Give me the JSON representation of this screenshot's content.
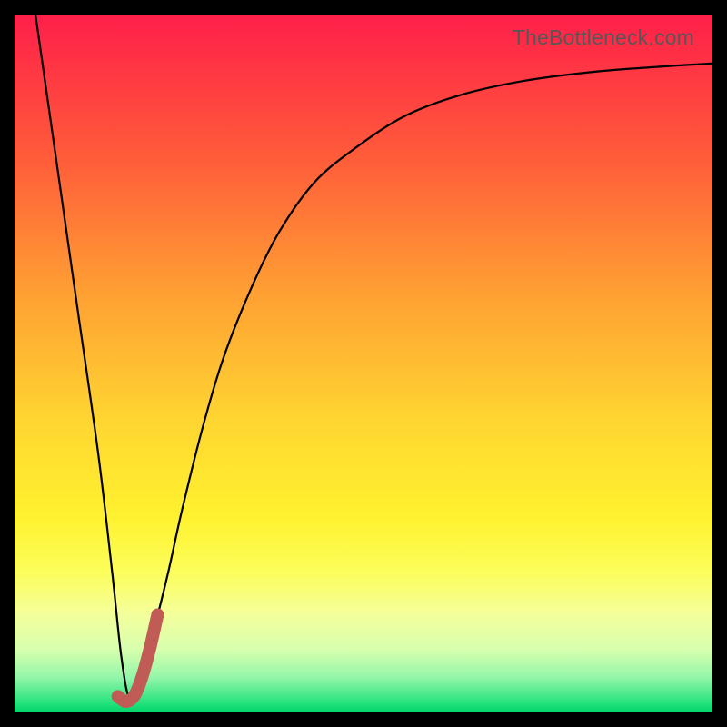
{
  "watermark": "TheBottleneck.com",
  "dimensions": {
    "outer": 800,
    "inset": 16
  },
  "chart_data": {
    "type": "line",
    "title": "",
    "xlabel": "",
    "ylabel": "",
    "xlim": [
      0,
      100
    ],
    "ylim": [
      0,
      100
    ],
    "grid": false,
    "legend": false,
    "gradient_stops": [
      {
        "pos": 0.0,
        "color": "#ff1f4a"
      },
      {
        "pos": 0.2,
        "color": "#ff5a3a"
      },
      {
        "pos": 0.4,
        "color": "#ffa033"
      },
      {
        "pos": 0.58,
        "color": "#ffd531"
      },
      {
        "pos": 0.72,
        "color": "#fff22f"
      },
      {
        "pos": 0.8,
        "color": "#fcfe5c"
      },
      {
        "pos": 0.86,
        "color": "#f4ff9c"
      },
      {
        "pos": 0.91,
        "color": "#d7ffae"
      },
      {
        "pos": 0.95,
        "color": "#94f6a9"
      },
      {
        "pos": 0.985,
        "color": "#29e37e"
      },
      {
        "pos": 1.0,
        "color": "#00d56a"
      }
    ],
    "series": [
      {
        "name": "bottleneck-curve",
        "stroke": "#000000",
        "stroke_width": 2.2,
        "x": [
          3.0,
          6.0,
          9.0,
          12.0,
          14.0,
          15.3,
          16.5,
          18.0,
          20.0,
          22.0,
          24.0,
          27.0,
          30.0,
          34.0,
          38.0,
          43.0,
          49.0,
          56.0,
          64.0,
          73.0,
          83.0,
          92.0,
          100.0
        ],
        "y": [
          100.0,
          79.0,
          58.0,
          37.0,
          20.0,
          8.0,
          2.0,
          5.0,
          12.0,
          20.0,
          29.0,
          41.0,
          51.0,
          61.0,
          69.0,
          76.0,
          81.0,
          85.5,
          88.5,
          90.5,
          91.8,
          92.5,
          93.0
        ]
      },
      {
        "name": "highlight-hook",
        "stroke": "#c15b55",
        "stroke_width": 14,
        "linecap": "round",
        "x": [
          14.8,
          15.8,
          16.6,
          17.4,
          18.4,
          19.4,
          20.5
        ],
        "y": [
          2.3,
          1.6,
          1.8,
          2.8,
          5.5,
          9.2,
          14.0
        ]
      }
    ],
    "annotations": []
  }
}
